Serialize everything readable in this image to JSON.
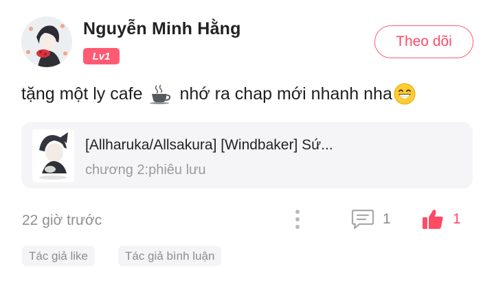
{
  "user": {
    "name": "Nguyễn Minh Hằng",
    "level": "Lv1"
  },
  "follow_button": {
    "label": "Theo dõi"
  },
  "comment": {
    "text_before": "tặng một ly cafe",
    "text_after": "nhớ ra chap mới nhanh nha",
    "inline_icons": [
      "coffee-cup-icon",
      "grinning-face-emoji"
    ]
  },
  "story": {
    "title": "[Allharuka/Allsakura] [Windbaker] Sứ...",
    "chapter": "chương 2:phiêu lưu"
  },
  "footer": {
    "timestamp": "22 giờ trước",
    "comment_count": "1",
    "like_count": "1"
  },
  "tags": [
    "Tác giả like",
    "Tác giả bình luận"
  ],
  "colors": {
    "accent": "#ff5a73",
    "muted_text": "#8f8f8f",
    "card_bg": "#f5f5f7"
  }
}
